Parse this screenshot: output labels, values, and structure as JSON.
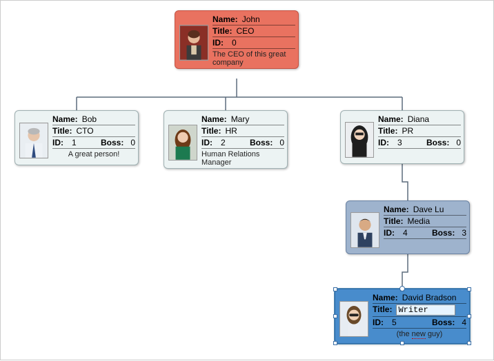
{
  "labels": {
    "name": "Name:",
    "title": "Title:",
    "id": "ID:",
    "boss": "Boss:"
  },
  "nodes": {
    "john": {
      "name": "John",
      "title": "CEO",
      "id": "0",
      "caption": "The CEO of this great company"
    },
    "bob": {
      "name": "Bob",
      "title": "CTO",
      "id": "1",
      "boss": "0",
      "caption": "A great person!"
    },
    "mary": {
      "name": "Mary",
      "title": "HR",
      "id": "2",
      "boss": "0",
      "caption": "Human Relations Manager"
    },
    "diana": {
      "name": "Diana",
      "title": "PR",
      "id": "3",
      "boss": "0"
    },
    "dave": {
      "name": "Dave Lu",
      "title": "Media",
      "id": "4",
      "boss": "3"
    },
    "david": {
      "name": "David Bradson",
      "title_value": "Writer",
      "id": "5",
      "boss": "4",
      "caption": "(the new guy)"
    }
  }
}
